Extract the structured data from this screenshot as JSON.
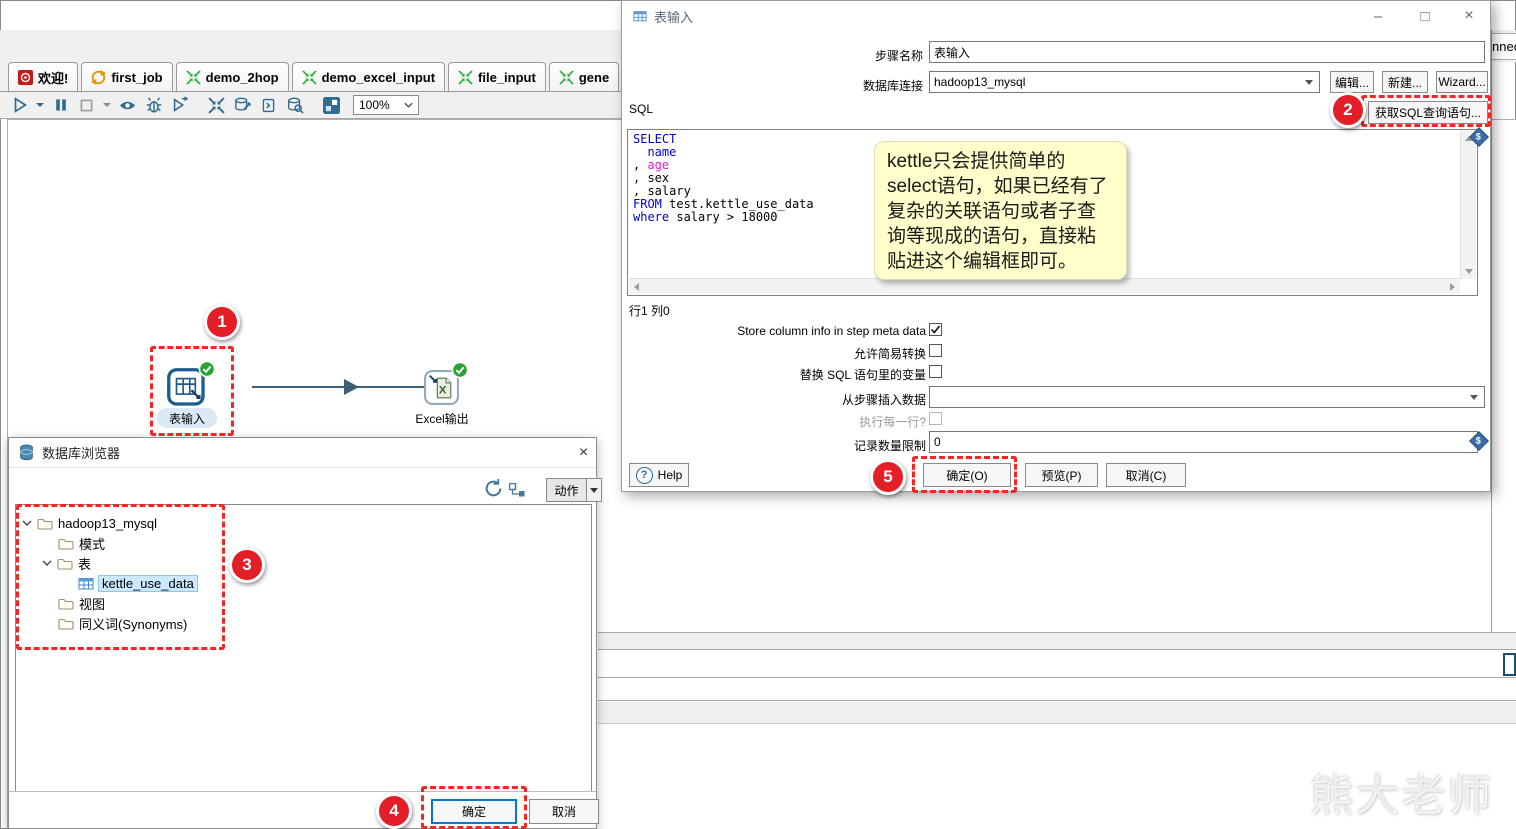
{
  "tabs": [
    {
      "label": "欢迎!"
    },
    {
      "label": "first_job"
    },
    {
      "label": "demo_2hop"
    },
    {
      "label": "demo_excel_input"
    },
    {
      "label": "file_input"
    },
    {
      "label": "gene"
    }
  ],
  "toolbar": {
    "zoom_level": "100%"
  },
  "background": {
    "fragment_text": "nnec"
  },
  "canvas": {
    "step1_label": "表输入",
    "step2_label": "Excel输出"
  },
  "table_input_dialog": {
    "title": "表输入",
    "step_name_label": "步骤名称",
    "step_name_value": "表输入",
    "connection_label": "数据库连接",
    "connection_value": "hadoop13_mysql",
    "edit_button": "编辑...",
    "new_button": "新建...",
    "wizard_button": "Wizard...",
    "sql_label": "SQL",
    "get_sql_button": "获取SQL查询语句...",
    "sql": {
      "l1_kw": "SELECT",
      "l2": "  name",
      "l3_pre": ", ",
      "l3_field": "age",
      "l4": ", sex",
      "l5": ", salary",
      "l6_kw": "FROM",
      "l6_rest": " test.kettle_use_data",
      "l7_kw": "where",
      "l7_rest": " salary > 18000"
    },
    "status_row_col": "行1 列0",
    "opt_store_meta": "Store column info in step meta data",
    "opt_store_meta_checked": true,
    "opt_easy_conversion": "允许简易转换",
    "opt_easy_conversion_checked": false,
    "opt_replace_vars": "替换 SQL 语句里的变量",
    "opt_replace_vars_checked": false,
    "insert_data_label": "从步骤插入数据",
    "insert_data_value": "",
    "exec_each_row_label": "执行每一行?",
    "exec_each_row_checked": false,
    "limit_label": "记录数量限制",
    "limit_value": "0",
    "help_button": "Help",
    "ok_button": "确定(O)",
    "preview_button": "预览(P)",
    "cancel_button": "取消(C)"
  },
  "db_browser": {
    "title": "数据库浏览器",
    "action_button": "动作",
    "tree_root": "hadoop13_mysql",
    "tree_schema": "模式",
    "tree_tables": "表",
    "tree_table_selected": "kettle_use_data",
    "tree_views": "视图",
    "tree_synonyms": "同义词(Synonyms)",
    "ok_button": "确定",
    "cancel_button": "取消"
  },
  "annotations": {
    "badge1": "1",
    "badge2": "2",
    "badge3": "3",
    "badge4": "4",
    "badge5": "5",
    "note_lines": [
      "kettle只会提供简单的",
      "select语句，如果已经有了",
      "复杂的关联语句或者子查",
      "询等现成的语句，直接粘",
      "贴进这个编辑框即可。"
    ]
  },
  "watermark": "熊大老师",
  "colors": {
    "annotation_red": "#f42525",
    "badge_red": "#e31e26",
    "sql_keyword_blue": "#0000cd",
    "sql_field_magenta": "#e818e8",
    "note_yellow": "#feffca",
    "selection_blue": "#cbe8ff",
    "icon_steel_blue": "#2e6b92",
    "check_green": "#23a52f",
    "job_icon_orange": "#e8930c",
    "trans_icon_green": "#2fae3e"
  }
}
